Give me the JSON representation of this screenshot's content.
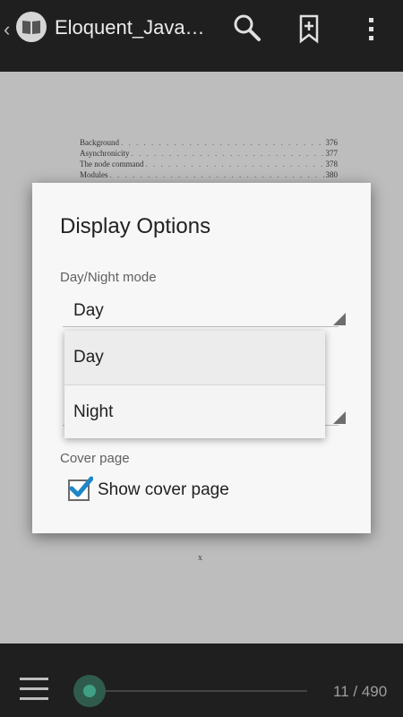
{
  "topbar": {
    "title": "Eloquent_Java…",
    "icons": [
      "back-chevron-icon",
      "book-icon",
      "search-icon",
      "bookmark-add-icon",
      "overflow-menu-icon"
    ]
  },
  "page": {
    "toc": [
      {
        "label": "Background",
        "page": "376"
      },
      {
        "label": "Asynchronicity",
        "page": "377"
      },
      {
        "label": "The node command",
        "page": "378"
      },
      {
        "label": "Modules",
        "page": "380"
      }
    ],
    "page_mark": "x"
  },
  "dialog": {
    "title": "Display Options",
    "daynight_label": "Day/Night mode",
    "daynight_value": "Day",
    "cover_label": "Cover page",
    "cover_checkbox_label": "Show cover page",
    "cover_checked": true
  },
  "dropdown": {
    "options": [
      "Day",
      "Night"
    ],
    "selected": "Day"
  },
  "bottombar": {
    "page_counter": "11 / 490",
    "progress_fraction": 0.0224
  },
  "colors": {
    "accent": "#3fa084",
    "checkbox_check": "#1e88c7",
    "bar_bg": "#1f1f1f"
  }
}
